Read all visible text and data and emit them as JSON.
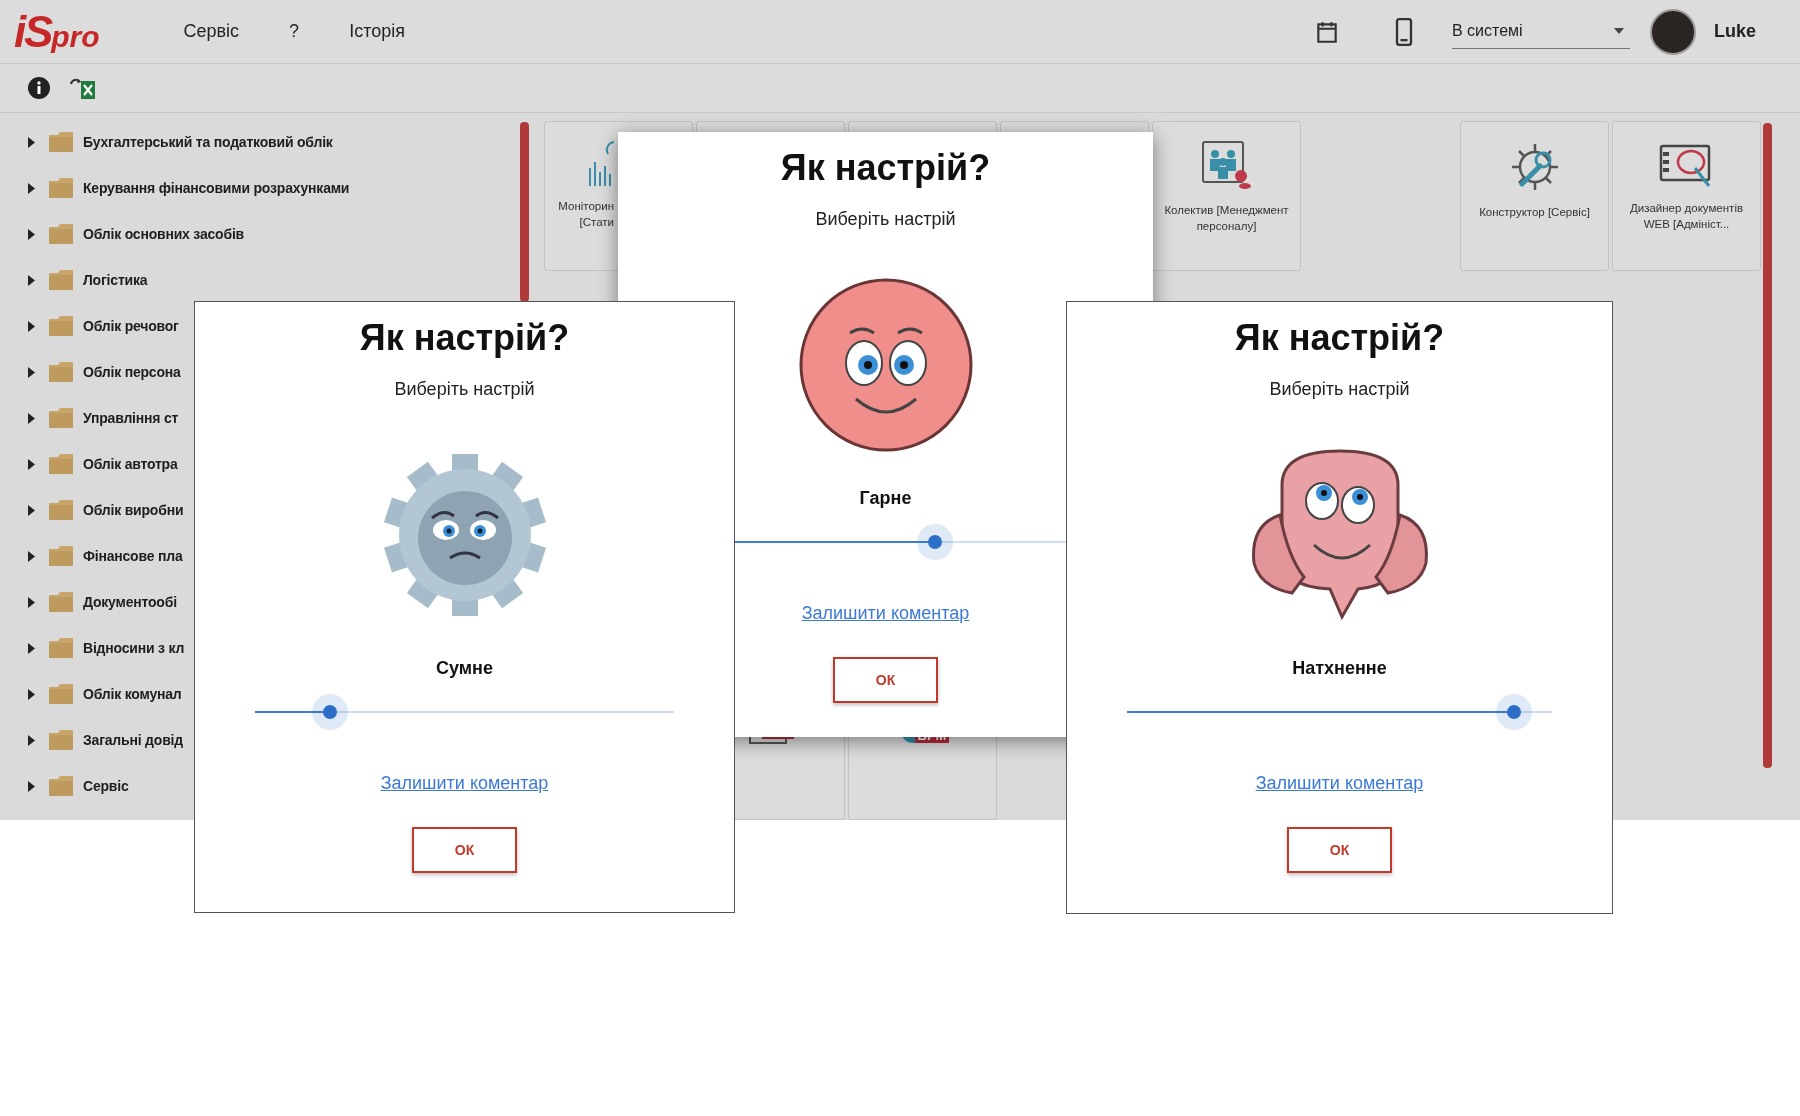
{
  "header": {
    "logo": {
      "mark": "iS",
      "text": "pro"
    },
    "menu": [
      {
        "label": "Сервіс"
      },
      {
        "label": "?"
      },
      {
        "label": "Історія"
      }
    ],
    "status_select": {
      "value": "В системі"
    },
    "user": {
      "name": "Luke"
    }
  },
  "sidebar": {
    "items": [
      {
        "label": "Бухгалтерський та податковий облік"
      },
      {
        "label": "Керування фінансовими розрахунками"
      },
      {
        "label": "Облік основних засобів"
      },
      {
        "label": "Логістика"
      },
      {
        "label": "Облік речовог"
      },
      {
        "label": "Облік персона"
      },
      {
        "label": "Управління ст"
      },
      {
        "label": "Облік автотра"
      },
      {
        "label": "Облік виробни"
      },
      {
        "label": "Фінансове пла"
      },
      {
        "label": "Документообі"
      },
      {
        "label": "Відносини з кл"
      },
      {
        "label": "Облік комунал"
      },
      {
        "label": "Загальні довід"
      },
      {
        "label": "Сервіс"
      }
    ]
  },
  "tiles_top": [
    {
      "kind": "monitoring",
      "lines": [
        "Моніторин",
        "[Стати"
      ]
    },
    {
      "kind": "covered"
    },
    {
      "kind": "covered"
    },
    {
      "kind": "covered"
    },
    {
      "kind": "team",
      "lines": [
        "Колектив [Менеджмент",
        "персоналу]"
      ]
    },
    {
      "kind": "gap"
    },
    {
      "kind": "constructor",
      "lines": [
        "Конструктор [Сервіс]"
      ]
    },
    {
      "kind": "designer",
      "lines": [
        "Дизайнер документів",
        "WEB [Адмініст..."
      ]
    }
  ],
  "tiles_bottom": [
    {
      "kind": "covered"
    },
    {
      "kind": "bpm-checklist"
    },
    {
      "kind": "bpm-chart"
    }
  ],
  "dialogs": [
    {
      "kind": "ball",
      "title": "Як настрій?",
      "subtitle": "Виберіть настрій",
      "mood": "Гарне",
      "level": 0.62,
      "link": "Залишити коментар",
      "ok": "ОК"
    },
    {
      "kind": "gear",
      "title": "Як настрій?",
      "subtitle": "Виберіть настрій",
      "mood": "Сумне",
      "level": 0.18,
      "link": "Залишити коментар",
      "ok": "ОК"
    },
    {
      "kind": "brain",
      "title": "Як настрій?",
      "subtitle": "Виберіть настрій",
      "mood": "Натхненне",
      "level": 0.91,
      "link": "Залишити коментар",
      "ok": "ОК"
    }
  ]
}
